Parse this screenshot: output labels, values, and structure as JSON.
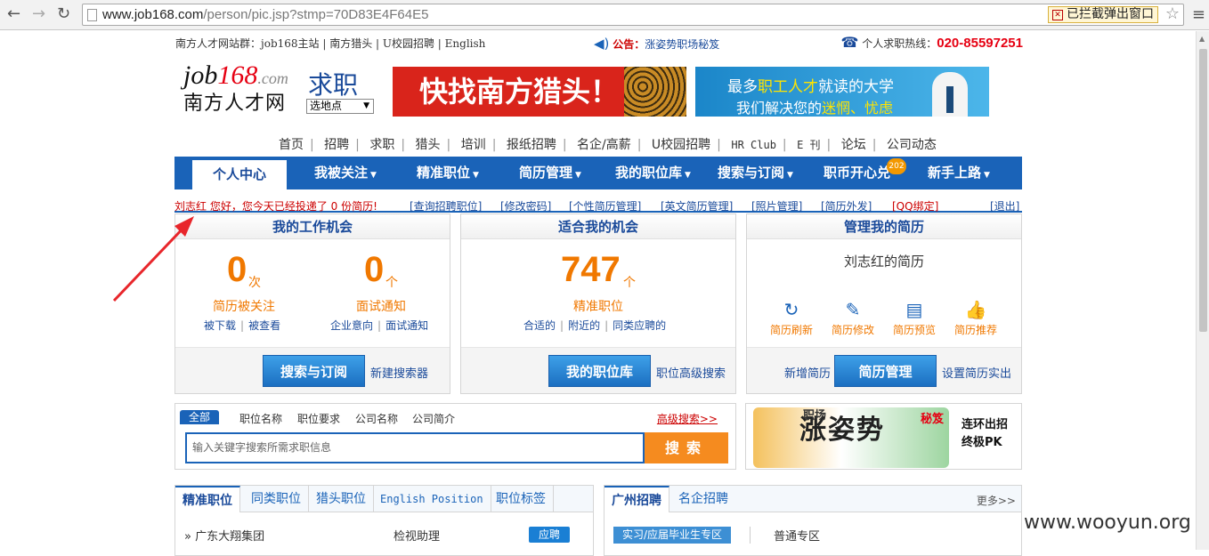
{
  "browser": {
    "url_host": "www.job168.com",
    "url_path": "/person/pic.jsp?stmp=70D83E4F64E5",
    "blocked_label": "已拦截弹出窗口"
  },
  "topbar": {
    "sites": "南方人才网站群：job168主站 | 南方猎头 | U校园招聘 | English",
    "notice_label": "公告：",
    "notice_text": "涨姿势职场秘笈",
    "hotline_label": "个人求职热线：",
    "hotline_number": "020-85597251"
  },
  "header": {
    "logo_en_black": "job",
    "logo_en_red": "168",
    "logo_en_suffix": ".com",
    "logo_cn": "南方人才网",
    "section": "求职",
    "location_select": "选地点",
    "banner1": "快找南方猎头！",
    "banner2_line1_a": "最多",
    "banner2_line1_b": "职工人才",
    "banner2_line1_c": "就读的大学",
    "banner2_line2_a": "我们解决您的",
    "banner2_line2_b": "迷惘、忧虑"
  },
  "links": [
    "首页",
    "招聘",
    "求职",
    "猎头",
    "培训",
    "报纸招聘",
    "名企/高薪",
    "U校园招聘",
    "HR Club",
    "E 刊",
    "论坛",
    "公司动态"
  ],
  "nav": {
    "items": [
      "个人中心",
      "我被关注",
      "精准职位",
      "简历管理",
      "我的职位库",
      "搜索与订阅",
      "职币开心兑",
      "新手上路"
    ],
    "badge": "202"
  },
  "welcome": {
    "text": "刘志红 您好，您今天已经投递了 0 份简历!",
    "links": [
      "[查询招聘职位]",
      "[修改密码]",
      "[个性简历管理]",
      "[英文简历管理]",
      "[照片管理]",
      "[简历外发]",
      "[QQ绑定]",
      "[退出]"
    ]
  },
  "panel1": {
    "title": "我的工作机会",
    "count1": "0",
    "unit1": "次",
    "label1": "简历被关注",
    "sub1a": "被下载",
    "sub1b": "被查看",
    "count2": "0",
    "unit2": "个",
    "label2": "面试通知",
    "sub2a": "企业意向",
    "sub2b": "面试通知",
    "button": "搜索与订阅",
    "link": "新建搜索器"
  },
  "panel2": {
    "title": "适合我的机会",
    "count": "747",
    "unit": "个",
    "label": "精准职位",
    "sub_a": "合适的",
    "sub_b": "附近的",
    "sub_c": "同类应聘的",
    "button": "我的职位库",
    "link": "职位高级搜索"
  },
  "panel3": {
    "title": "管理我的简历",
    "resume_name": "刘志红的简历",
    "tools": [
      "简历刷新",
      "简历修改",
      "简历预览",
      "简历推荐"
    ],
    "link_left": "新增简历",
    "button": "简历管理",
    "link_right": "设置简历实出"
  },
  "search": {
    "tabs": [
      "全部",
      "职位名称",
      "职位要求",
      "公司名称",
      "公司简介"
    ],
    "advanced": "高级搜索>>",
    "placeholder": "输入关键字搜索所需求职信息",
    "button": "搜索"
  },
  "ad": {
    "big": "涨姿势",
    "small_a": "职场",
    "small_b": "秘笈",
    "right_line1": "连环出招",
    "right_line2": "终极PK"
  },
  "jobs": {
    "tabs": [
      "精准职位",
      "同类职位",
      "猎头职位",
      "English Position",
      "职位标签"
    ],
    "row_company": "广东大翔集团",
    "row_title": "检视助理",
    "apply": "应聘"
  },
  "gz": {
    "tabs": [
      "广州招聘",
      "名企招聘"
    ],
    "more": "更多>>",
    "intern": "实习/应届毕业生专区",
    "normal": "普通专区"
  },
  "watermark": "www.wooyun.org"
}
